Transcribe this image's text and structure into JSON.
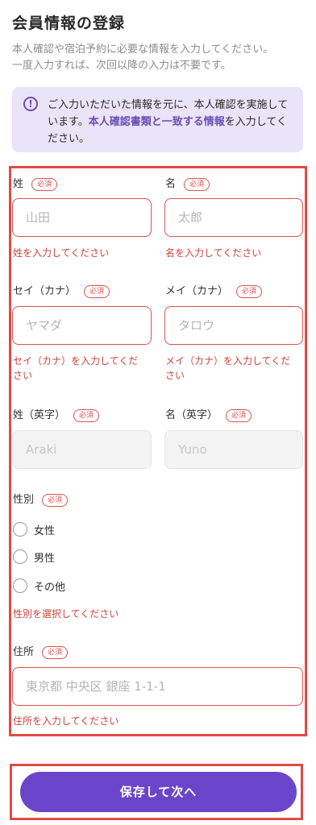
{
  "header": {
    "title": "会員情報の登録",
    "subtitle_line1": "本人確認や宿泊予約に必要な情報を入力してください。",
    "subtitle_line2": "一度入力すれば、次回以降の入力は不要です。"
  },
  "notice": {
    "icon": "info-circle-icon",
    "text_before": "ご入力いただいた情報を元に、本人確認を実施しています。",
    "text_highlight": "本人確認書類と一致する情報",
    "text_after": "を入力してください。"
  },
  "form": {
    "required_badge": "必須",
    "last_name": {
      "label": "姓",
      "placeholder": "山田",
      "error": "姓を入力してください"
    },
    "first_name": {
      "label": "名",
      "placeholder": "太郎",
      "error": "名を入力してください"
    },
    "last_name_kana": {
      "label": "セイ（カナ）",
      "placeholder": "ヤマダ",
      "error_line1": "セイ（カナ）を入力してくだ",
      "error_line2": "さい"
    },
    "first_name_kana": {
      "label": "メイ（カナ）",
      "placeholder": "タロウ",
      "error_line1": "メイ（カナ）を入力してくだ",
      "error_line2": "さい"
    },
    "last_name_en": {
      "label": "姓（英字）",
      "placeholder": "Araki"
    },
    "first_name_en": {
      "label": "名（英字）",
      "placeholder": "Yuno"
    },
    "gender": {
      "label": "性別",
      "options": [
        "女性",
        "男性",
        "その他"
      ],
      "error": "性別を選択してください"
    },
    "address": {
      "label": "住所",
      "placeholder": "東京都 中央区 銀座 1-1-1",
      "error": "住所を入力してください"
    }
  },
  "actions": {
    "save_label": "保存して次へ"
  },
  "colors": {
    "accent": "#6b45c9",
    "error": "#d0413b",
    "notice_bg": "#ebe3f7"
  }
}
